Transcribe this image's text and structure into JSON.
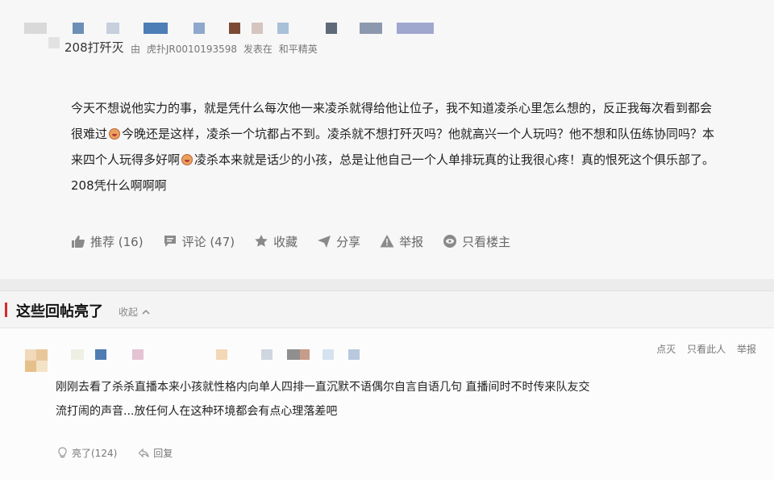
{
  "post": {
    "author_name": "208打歼灭",
    "meta": {
      "by_label": "由",
      "source": "虎扑JR0010193598",
      "posted_in": "发表在",
      "forum": "和平精英"
    },
    "body": {
      "line1": "今天不想说他实力的事，就是凭什么每次他一来凌杀就得给他让位子，我不知道凌杀心里怎么想的，反正我每次看到都会",
      "line2a": "很难过",
      "line2b": "今晚还是这样，凌杀一个坑都占不到。凌杀就不想打歼灭吗？他就高兴一个人玩吗？他不想和队伍练协同吗？本",
      "line3a": "来四个人玩得多好啊",
      "line3b": "凌杀本来就是话少的小孩，总是让他自己一个人单排玩真的让我很心疼！真的恨死这个俱乐部了。",
      "line4": "208凭什么啊啊啊"
    },
    "actions": {
      "recommend": "推荐 (16)",
      "comment": "评论 (47)",
      "favorite": "收藏",
      "share": "分享",
      "report": "举报",
      "owner_only": "只看楼主"
    }
  },
  "replies": {
    "title": "这些回帖亮了",
    "collapse": "收起",
    "item": {
      "tools": {
        "downvote": "点灭",
        "only_this": "只看此人",
        "report": "举报"
      },
      "body": {
        "line1": "刚刚去看了杀杀直播本来小孩就性格内向单人四排一直沉默不语偶尔自言自语几句 直播间时不时传来队友交",
        "line2": "流打闹的声音...放任何人在这种环境都会有点心理落差吧"
      },
      "actions": {
        "light": "亮了(124)",
        "reply": "回复"
      }
    }
  },
  "icons": {
    "recommend": "thumbs-up-icon",
    "comment": "comment-bubble-icon",
    "favorite": "star-icon",
    "share": "paper-plane-icon",
    "report": "warning-icon",
    "owner_only": "eye-circle-icon",
    "light": "light-bulb-icon",
    "reply": "reply-arrow-icon",
    "collapse": "chevron-up-icon"
  },
  "colors": {
    "accent_red": "#d52b2b",
    "text_gray": "#666666"
  }
}
